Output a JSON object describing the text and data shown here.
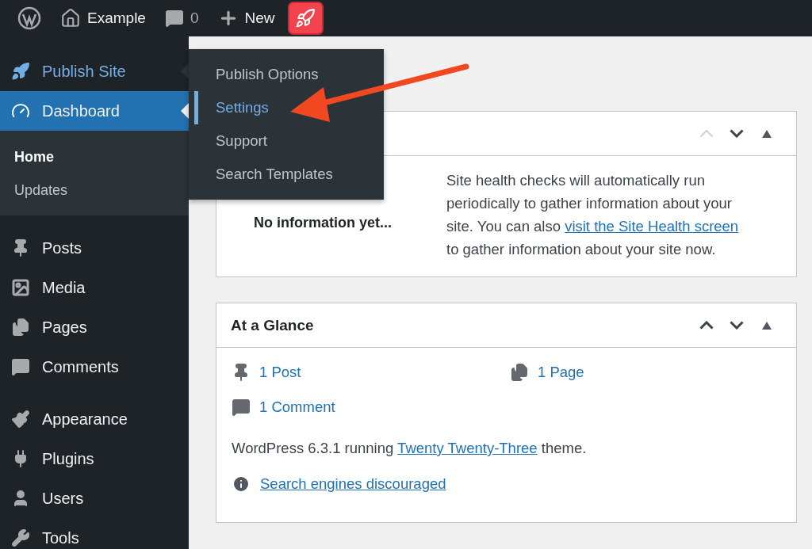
{
  "admin_bar": {
    "site_name": "Example",
    "comments_count": "0",
    "new_label": "New"
  },
  "sidebar": {
    "groups": [
      {
        "items": [
          {
            "label": "Publish Site",
            "selected": false,
            "expanded": true
          },
          {
            "label": "Dashboard",
            "selected": true,
            "expanded": false,
            "children": [
              {
                "label": "Home",
                "selected": true
              },
              {
                "label": "Updates",
                "selected": false
              }
            ]
          }
        ]
      },
      {
        "items": [
          {
            "label": "Posts",
            "selected": false,
            "expanded": false
          },
          {
            "label": "Media",
            "selected": false,
            "expanded": false
          },
          {
            "label": "Pages",
            "selected": false,
            "expanded": false
          },
          {
            "label": "Comments",
            "selected": false,
            "expanded": false
          }
        ]
      },
      {
        "items": [
          {
            "label": "Appearance",
            "selected": false,
            "expanded": false
          },
          {
            "label": "Plugins",
            "selected": false,
            "expanded": false
          },
          {
            "label": "Users",
            "selected": false,
            "expanded": false
          },
          {
            "label": "Tools",
            "selected": false,
            "expanded": false
          }
        ]
      }
    ]
  },
  "flyout_menu": {
    "items": [
      {
        "label": "Publish Options",
        "selected": false
      },
      {
        "label": "Settings",
        "selected": true
      },
      {
        "label": "Support",
        "selected": false
      },
      {
        "label": "Search Templates",
        "selected": false
      }
    ]
  },
  "widgets": [
    {
      "kind": "site_health",
      "move_up_disabled": true,
      "status": "No information yet...",
      "text_before": "Site health checks will automatically run periodically to gather information about your site. You can also ",
      "link": "visit the Site Health screen",
      "text_after": " to gather information about your site now."
    },
    {
      "kind": "glance",
      "title": "At a Glance",
      "move_up_disabled": false,
      "counts": [
        {
          "label": "1 Post"
        },
        {
          "label": "1 Page"
        },
        {
          "label": "1 Comment"
        }
      ],
      "version_before": "WordPress 6.3.1 running ",
      "theme_link": "Twenty Twenty-Three",
      "version_after": " theme.",
      "notice": "Search engines discouraged"
    }
  ]
}
